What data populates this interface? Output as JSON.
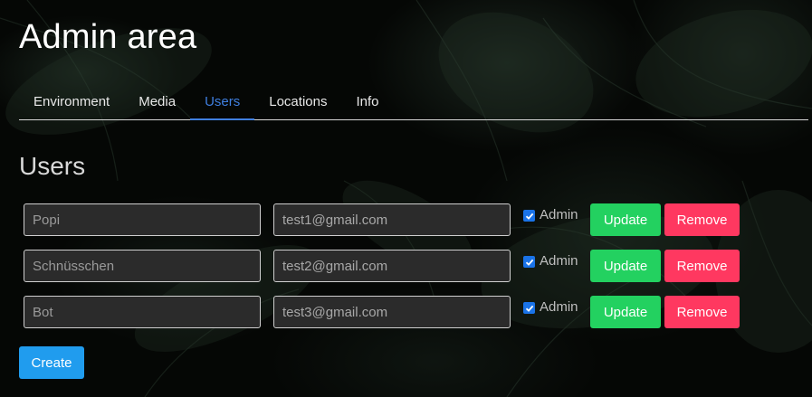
{
  "page": {
    "title": "Admin area"
  },
  "tabs": [
    {
      "label": "Environment",
      "active": false
    },
    {
      "label": "Media",
      "active": false
    },
    {
      "label": "Users",
      "active": true
    },
    {
      "label": "Locations",
      "active": false
    },
    {
      "label": "Info",
      "active": false
    }
  ],
  "section": {
    "title": "Users"
  },
  "users": [
    {
      "name": "Popi",
      "email": "test1@gmail.com",
      "admin_label": "Admin",
      "admin_checked": true,
      "update_label": "Update",
      "remove_label": "Remove"
    },
    {
      "name": "Schnüsschen",
      "email": "test2@gmail.com",
      "admin_label": "Admin",
      "admin_checked": true,
      "update_label": "Update",
      "remove_label": "Remove"
    },
    {
      "name": "Bot",
      "email": "test3@gmail.com",
      "admin_label": "Admin",
      "admin_checked": true,
      "update_label": "Update",
      "remove_label": "Remove"
    }
  ],
  "actions": {
    "create_label": "Create"
  },
  "colors": {
    "active_tab": "#3f7fe0",
    "update": "#23d160",
    "remove": "#ff3860",
    "create": "#209cee",
    "checkbox": "#1a73e8"
  }
}
